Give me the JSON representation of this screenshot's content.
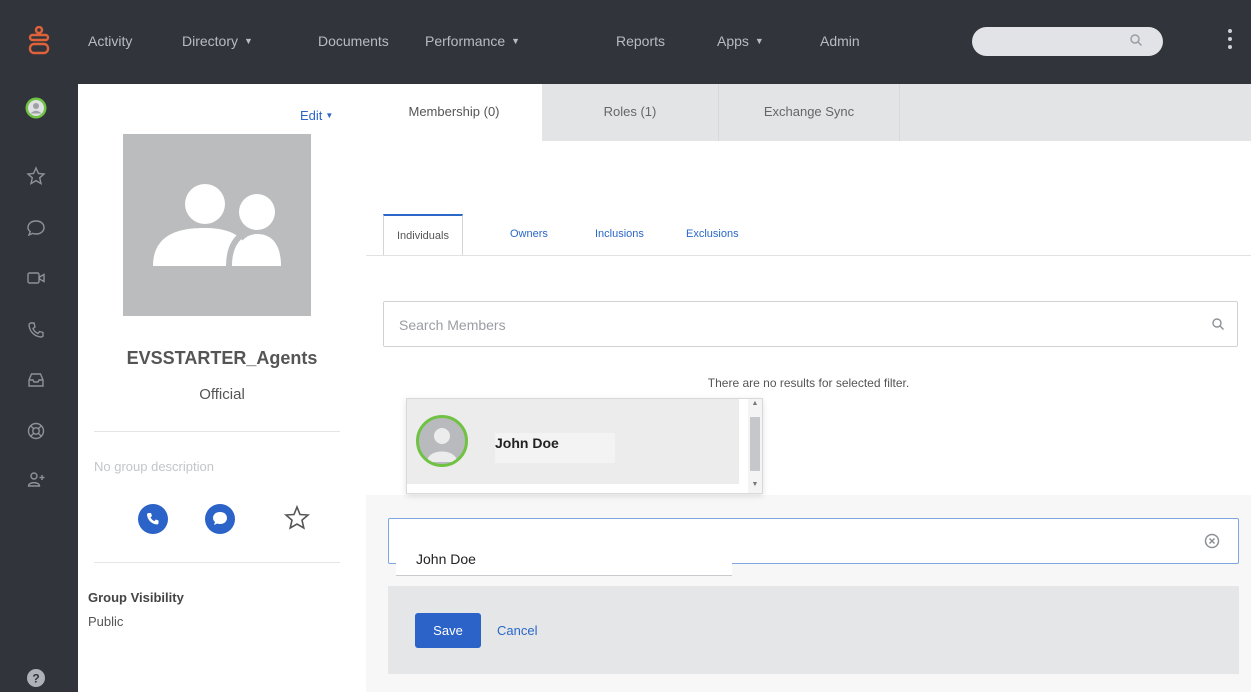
{
  "nav": {
    "items": [
      {
        "label": "Activity",
        "dropdown": false
      },
      {
        "label": "Directory",
        "dropdown": true
      },
      {
        "label": "Documents",
        "dropdown": false
      },
      {
        "label": "Performance",
        "dropdown": true
      },
      {
        "label": "Reports",
        "dropdown": false
      },
      {
        "label": "Apps",
        "dropdown": true
      },
      {
        "label": "Admin",
        "dropdown": false
      }
    ],
    "search_placeholder": "",
    "menu_icon": "kebab-icon"
  },
  "rail": {
    "icons": [
      "presence-avatar-icon",
      "star-icon",
      "chat-icon",
      "video-icon",
      "phone-icon",
      "inbox-icon",
      "support-icon",
      "people-icon"
    ],
    "help_icon": "help-icon"
  },
  "profile": {
    "edit_label": "Edit",
    "group_name": "EVSSTARTER_Agents",
    "group_type": "Official",
    "description": "No group description",
    "visibility_label": "Group Visibility",
    "visibility_value": "Public"
  },
  "tabs": [
    {
      "label": "Membership (0)",
      "active": true
    },
    {
      "label": "Roles (1)",
      "active": false
    },
    {
      "label": "Exchange Sync",
      "active": false
    }
  ],
  "subtabs": [
    {
      "label": "Individuals",
      "active": true
    },
    {
      "label": "Owners",
      "active": false
    },
    {
      "label": "Inclusions",
      "active": false
    },
    {
      "label": "Exclusions",
      "active": false
    }
  ],
  "members": {
    "search_placeholder": "Search Members",
    "empty_message": "There are no results for selected filter."
  },
  "dropdown": {
    "option_name": "John Doe"
  },
  "add_member": {
    "value": "John Doe"
  },
  "actions": {
    "save": "Save",
    "cancel": "Cancel"
  },
  "colors": {
    "nav_bg": "#31343a",
    "accent": "#2b63c9",
    "link": "#2a67c9",
    "presence": "#70c243",
    "logo": "#e0623a"
  }
}
